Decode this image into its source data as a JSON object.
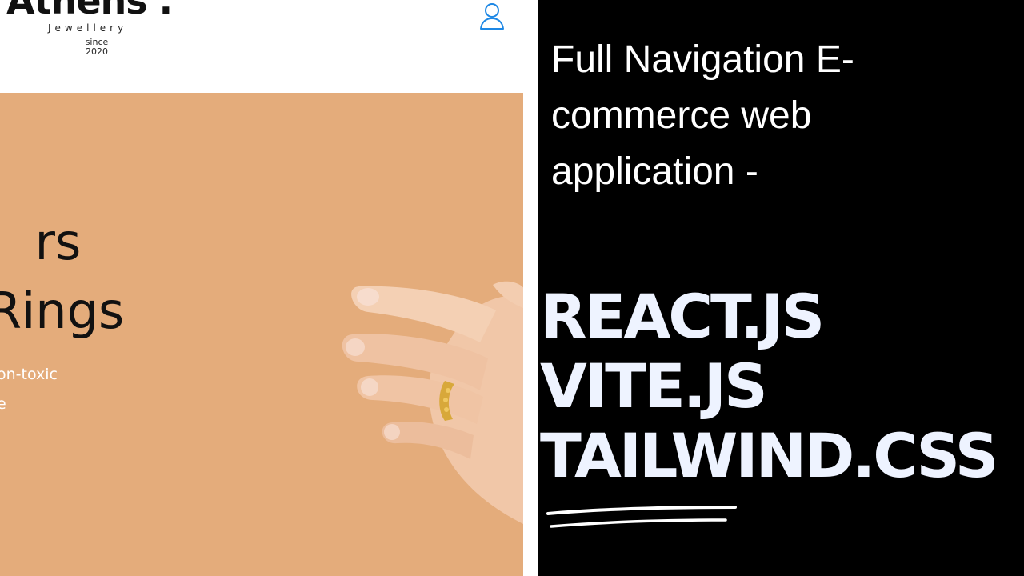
{
  "site": {
    "logo": {
      "word": "Athens .",
      "subtitle": "Jewellery",
      "since": "since 2020"
    },
    "hero": {
      "title_line1": "rs",
      "title_line2": "Rings",
      "text_line1": "on-toxic",
      "text_line2": "e"
    }
  },
  "promo": {
    "subtitle": "Full Navigation E-commerce web application -",
    "stack": [
      "REACT.JS",
      "VITE.JS",
      "TAILWIND.CSS"
    ]
  },
  "colors": {
    "hero_bg": "#e4ac7b",
    "user_icon": "#1e88e5",
    "promo_bg": "#000000",
    "promo_text": "#eef3ff"
  },
  "icons": {
    "user": "user-outline-icon"
  }
}
